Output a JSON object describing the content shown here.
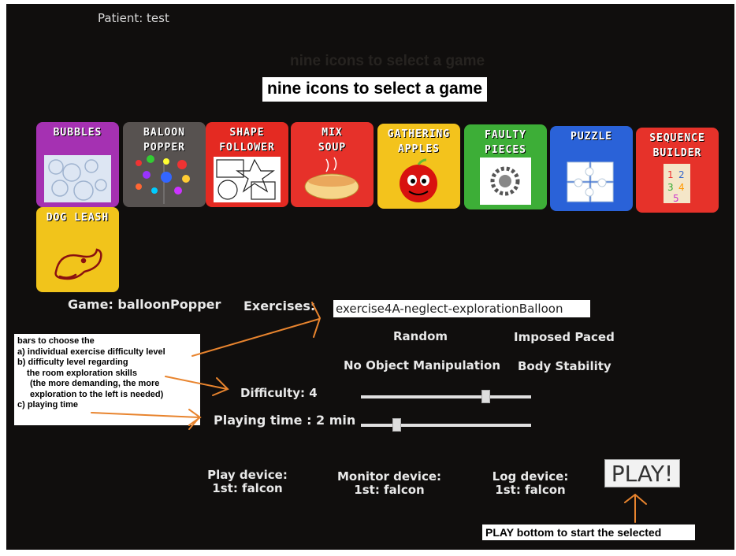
{
  "patient": "Patient: test",
  "ghost_title": "nine icons to select a game",
  "banner": "nine icons to select a game",
  "games": [
    {
      "label": "BUBBLES",
      "color": "#a531b2"
    },
    {
      "label": "BALOON\nPOPPER",
      "color": "#575250"
    },
    {
      "label": "SHAPE\nFOLLOWER",
      "color": "#e42a22"
    },
    {
      "label": "MIX\nSOUP",
      "color": "#e6312a"
    },
    {
      "label": "GATHERING\nAPPLES",
      "color": "#f3c31c"
    },
    {
      "label": "FAULTY\nPIECES",
      "color": "#3dae37"
    },
    {
      "label": "PUZZLE",
      "color": "#2a62d8"
    },
    {
      "label": "SEQUENCE\nBUILDER",
      "color": "#e6322a"
    },
    {
      "label": "DOG LEASH",
      "color": "#f1c41b"
    }
  ],
  "game_text": "Game: balloonPopper",
  "exercises_label": "Exercises:",
  "exercise_value": "exercise4A-neglect-explorationBalloon",
  "options": {
    "random": "Random",
    "imposed_paced": "Imposed Paced",
    "no_object": "No Object Manipulation",
    "body_stability": "Body Stability"
  },
  "difficulty_label": "Difficulty: 4",
  "difficulty_level": 0.73,
  "playing_time_label": "Playing time : 2 min",
  "playing_time_level": 0.21,
  "devices": {
    "play": {
      "label": "Play device:",
      "value": "1st: falcon"
    },
    "monitor": {
      "label": "Monitor device:",
      "value": "1st: falcon"
    },
    "log": {
      "label": "Log device:",
      "value": "1st: falcon"
    }
  },
  "play_button": "PLAY!",
  "notes": {
    "line1": "bars to choose the",
    "line2": "a) individual exercise difficulty level",
    "line3": "b) difficulty level regarding",
    "line4": "the room exploration skills",
    "line5": "(the more demanding, the more",
    "line6": "exploration to the left is needed)",
    "line7": "c) playing time"
  },
  "play_note": "PLAY bottom to start the selected",
  "arrow_color": "#e8842e"
}
